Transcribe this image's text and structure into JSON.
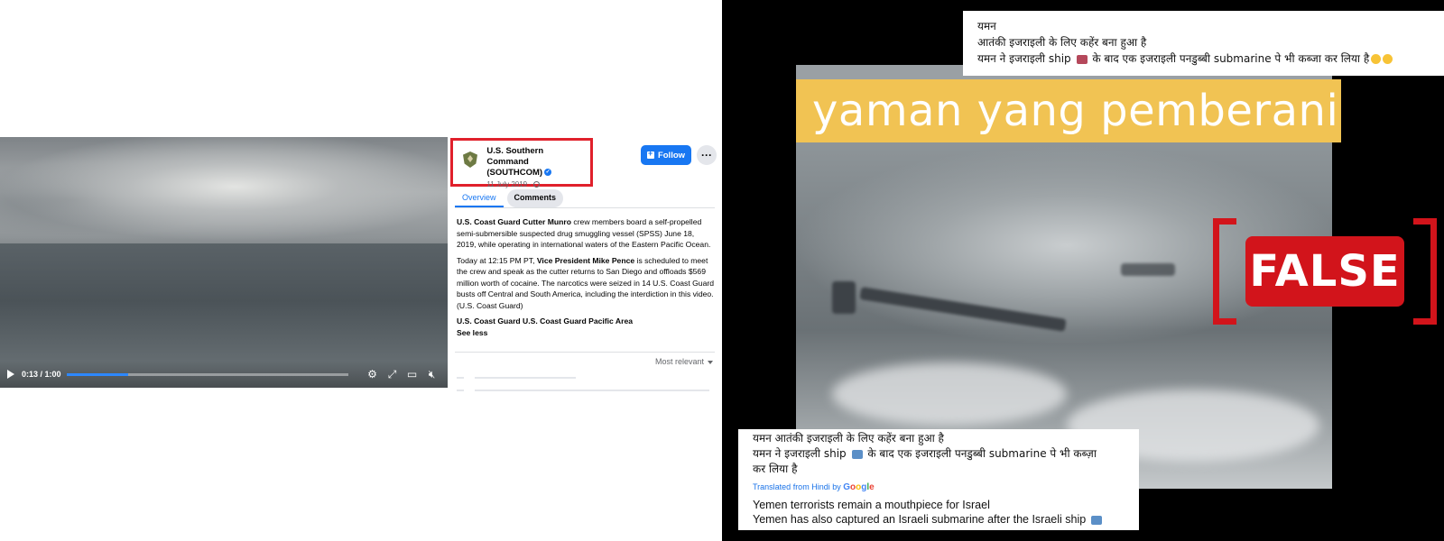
{
  "facebook": {
    "video": {
      "time": "0:13 / 1:00",
      "progress_fraction": 0.22
    },
    "page": {
      "name_line1": "U.S. Southern Command",
      "name_line2": "(SOUTHCOM)",
      "date": "11 July 2019 ·"
    },
    "follow_label": "Follow",
    "more_label": "···",
    "tabs": [
      {
        "label": "Overview"
      },
      {
        "label": "Comments"
      }
    ],
    "body": {
      "p1_bold": "U.S. Coast Guard Cutter Munro",
      "p1_rest": " crew members board a self-propelled semi-submersible suspected drug smuggling vessel (SPSS) June 18, 2019, while operating in international waters of the Eastern Pacific Ocean.",
      "p2_pre": "Today at 12:15 PM PT, ",
      "p2_bold": "Vice President Mike Pence",
      "p2_rest": " is scheduled to meet the crew and speak as the cutter returns to San Diego and offloads $569 million worth of cocaine. The narcotics were seized in 14 U.S. Coast Guard busts off Central and South America, including the interdiction in this video. (U.S. Coast Guard)",
      "tags": "U.S. Coast Guard U.S. Coast Guard Pacific Area",
      "see_less": "See less"
    },
    "sort_label": "Most relevant"
  },
  "factcheck": {
    "video_caption": "yaman yang pemberani",
    "verdict": "FALSE",
    "hindi_top": {
      "line1": "यमन",
      "line2": "आतंकी इजराइली के लिए कहेंर बना हुआ है",
      "line3_pre": "यमन ने इजराइली ship",
      "line3_post": "के बाद एक इजराइली पनडुब्बी submarine पे भी कब्जा कर लिया है"
    },
    "hindi_bottom": {
      "line1": "यमन आतंकी इजराइली के लिए कहेंर बना हुआ है",
      "line2_pre": "यमन ने इजराइली ship",
      "line2_post": "के बाद एक इजराइली पनडुब्बी submarine पे भी कब्ज़ा",
      "line3": "कर लिया है",
      "translated_label": "Translated from Hindi by",
      "google": [
        "G",
        "o",
        "o",
        "g",
        "l",
        "e"
      ],
      "english1": "Yemen terrorists remain a mouthpiece for Israel",
      "english2": "Yemen has also captured an Israeli submarine after the Israeli ship"
    },
    "colors": {
      "caption_bar": "#f1c353",
      "stamp_red": "#d2141b",
      "fb_blue": "#1877f2"
    }
  }
}
